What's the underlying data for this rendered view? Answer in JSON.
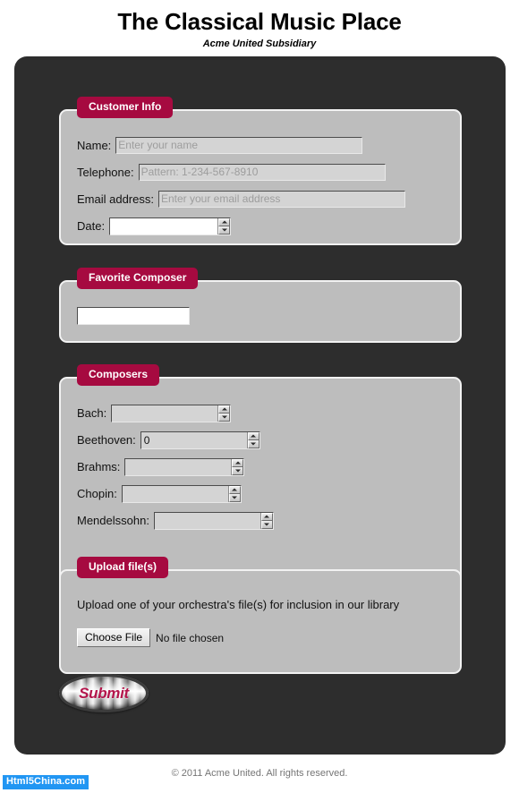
{
  "header": {
    "title": "The Classical Music Place",
    "subtitle": "Acme United Subsidiary"
  },
  "colors": {
    "legend_bg": "#a60a40",
    "panel_bg": "#2d2d2d",
    "fieldset_bg": "#bdbdbd",
    "submit_text": "#b4154b",
    "watermark_bg": "#2196f3"
  },
  "customer_info": {
    "legend": "Customer Info",
    "fields": [
      {
        "label": "Name:",
        "placeholder": "Enter your name",
        "value": ""
      },
      {
        "label": "Telephone:",
        "placeholder": "Pattern: 1-234-567-8910",
        "value": ""
      },
      {
        "label": "Email address:",
        "placeholder": "Enter your email address",
        "value": ""
      },
      {
        "label": "Date:",
        "placeholder": "",
        "value": ""
      }
    ]
  },
  "favorite_composer": {
    "legend": "Favorite Composer",
    "input_value": "",
    "input_placeholder": ""
  },
  "composers": {
    "legend": "Composers",
    "items": [
      {
        "label": "Bach:",
        "value": ""
      },
      {
        "label": "Beethoven:",
        "value": "0"
      },
      {
        "label": "Brahms:",
        "value": ""
      },
      {
        "label": "Chopin:",
        "value": ""
      },
      {
        "label": "Mendelssohn:",
        "value": ""
      }
    ]
  },
  "upload": {
    "legend": "Upload file(s)",
    "description": "Upload one of your orchestra's file(s) for inclusion in our library",
    "choose_button": "Choose File",
    "file_status": "No file chosen"
  },
  "submit": {
    "label": "Submit"
  },
  "footer": {
    "copyright": "© 2011 Acme United. All rights reserved.",
    "watermark": "Html5China.com"
  }
}
